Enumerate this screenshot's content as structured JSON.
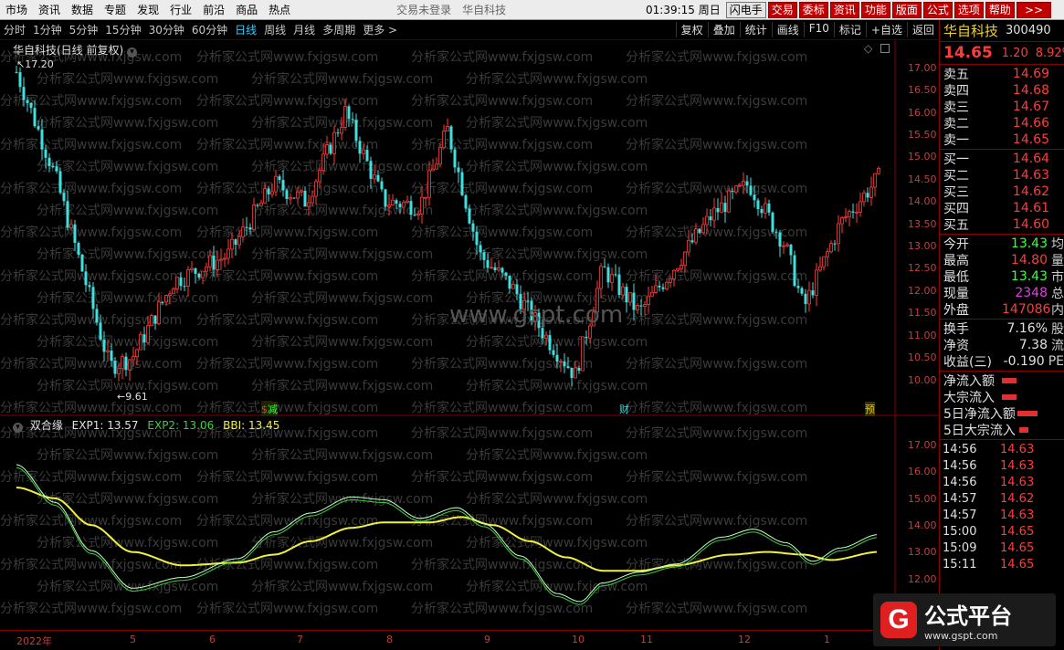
{
  "menubar": {
    "items": [
      "市场",
      "资讯",
      "数据",
      "专题",
      "发现",
      "行业",
      "前沿",
      "商品",
      "热点"
    ],
    "status_login": "交易未登录",
    "status_stock": "华自科技",
    "time": "01:39:15",
    "weekday": "周日",
    "buttons": [
      "闪电手",
      "交易",
      "委标",
      "资讯",
      "功能",
      "版面",
      "公式",
      "选项",
      "帮助"
    ],
    "more": ">>"
  },
  "periodbar": {
    "periods": [
      "分时",
      "1分钟",
      "5分钟",
      "15分钟",
      "30分钟",
      "60分钟",
      "日线",
      "周线",
      "月线",
      "多周期",
      "更多 >"
    ],
    "active": "日线",
    "tools": [
      "复权",
      "叠加",
      "统计",
      "画线",
      "F10",
      "标记",
      "+自选",
      "返回"
    ]
  },
  "main_chart": {
    "title": "华自科技(日线 前复权)",
    "high_label": "17.20",
    "low_label": "9.61",
    "watermark": "www.gspt.com",
    "watermark_repeat": "分析家公式网www.fxjgsw.com",
    "events": [
      {
        "label": "减"
      },
      {
        "label": "财"
      },
      {
        "label": "预"
      }
    ],
    "y_ticks": [
      "17.00",
      "16.50",
      "16.00",
      "15.50",
      "15.00",
      "14.50",
      "14.00",
      "13.50",
      "13.00",
      "12.50",
      "12.00",
      "11.50",
      "11.00",
      "10.50",
      "10.00"
    ]
  },
  "sub_chart": {
    "name": "双合缘",
    "exp1_label": "EXP1: 13.57",
    "exp2_label": "EXP2: 13.06",
    "bbi_label": "BBI: 13.45",
    "y_ticks": [
      "17.00",
      "16.00",
      "15.00",
      "14.00",
      "13.00",
      "12.00"
    ]
  },
  "x_axis": {
    "labels": [
      "2022年",
      "5",
      "6",
      "7",
      "8",
      "9",
      "10",
      "11",
      "12",
      "1"
    ]
  },
  "right_panel": {
    "name": "华自科技",
    "code": "300490",
    "price": "14.65",
    "change": "1.20",
    "pct": "8.92%",
    "asks": [
      {
        "label": "卖五",
        "price": "14.69"
      },
      {
        "label": "卖四",
        "price": "14.68"
      },
      {
        "label": "卖三",
        "price": "14.67"
      },
      {
        "label": "卖二",
        "price": "14.66"
      },
      {
        "label": "卖一",
        "price": "14.65"
      }
    ],
    "bids": [
      {
        "label": "买一",
        "price": "14.64"
      },
      {
        "label": "买二",
        "price": "14.63"
      },
      {
        "label": "买三",
        "price": "14.62"
      },
      {
        "label": "买四",
        "price": "14.61"
      },
      {
        "label": "买五",
        "price": "14.60"
      }
    ],
    "stats": [
      {
        "label": "今开",
        "value": "13.43",
        "extra": "均",
        "color": "#3cff3c"
      },
      {
        "label": "最高",
        "value": "14.80",
        "extra": "量",
        "color": "#ff3b3b"
      },
      {
        "label": "最低",
        "value": "13.43",
        "extra": "市",
        "color": "#3cff3c"
      },
      {
        "label": "现量",
        "value": "2348",
        "extra": "总",
        "color": "#e040e0"
      },
      {
        "label": "外盘",
        "value": "147086",
        "extra": "内",
        "color": "#ff3b3b"
      }
    ],
    "stats2": [
      {
        "label": "换手",
        "value": "7.16%",
        "extra": "股",
        "color": "#e0e0e0"
      },
      {
        "label": "净资",
        "value": "7.38",
        "extra": "流",
        "color": "#e0e0e0"
      },
      {
        "label": "收益(三)",
        "value": "-0.190",
        "extra": "PE",
        "color": "#e0e0e0"
      }
    ],
    "flows": [
      {
        "label": "净流入额",
        "level": 0.4
      },
      {
        "label": "大宗流入",
        "level": 0.4
      },
      {
        "label": "5日净流入额",
        "level": 0.6
      },
      {
        "label": "5日大宗流入",
        "level": 0.3
      }
    ],
    "ticks": [
      {
        "time": "14:56",
        "price": "14.63"
      },
      {
        "time": "14:56",
        "price": "14.63"
      },
      {
        "time": "14:56",
        "price": "14.63"
      },
      {
        "time": "14:57",
        "price": "14.62"
      },
      {
        "time": "14:57",
        "price": "14.63"
      },
      {
        "time": "15:00",
        "price": "14.65"
      },
      {
        "time": "15:09",
        "price": "14.65"
      },
      {
        "time": "15:11",
        "price": "14.65"
      }
    ]
  },
  "logo": {
    "letter": "G",
    "title": "公式平台",
    "url": "www.gspt.com"
  },
  "colors": {
    "up": "#ff3b3b",
    "down": "#40e0e0",
    "exp1": "#c8ffc8",
    "exp2": "#3cd03c",
    "bbi": "#f0f040"
  }
}
